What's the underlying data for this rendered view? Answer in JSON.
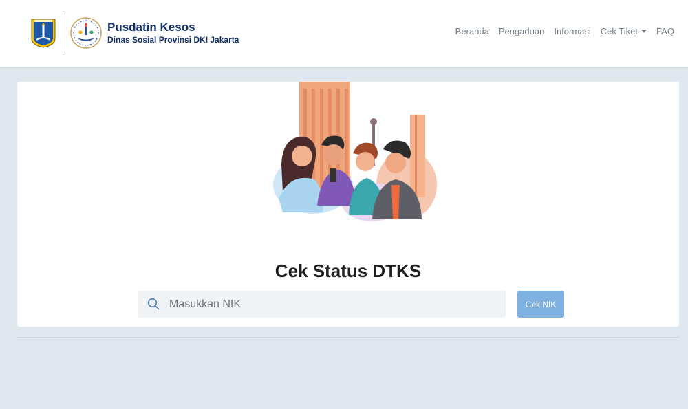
{
  "header": {
    "brand_title": "Pusdatin Kesos",
    "brand_subtitle": "Dinas Sosial Provinsi DKI Jakarta",
    "nav": [
      {
        "label": "Beranda"
      },
      {
        "label": "Pengaduan"
      },
      {
        "label": "Informasi"
      },
      {
        "label": "Cek Tiket"
      },
      {
        "label": "FAQ"
      }
    ]
  },
  "main": {
    "title": "Cek Status DTKS",
    "search": {
      "placeholder": "Masukkan NIK",
      "value": ""
    },
    "button_label": "Cek NIK"
  },
  "colors": {
    "brand": "#14316b",
    "button": "#7eb1e0",
    "background": "#dfe7f0"
  },
  "icons": [
    "dki-jakarta-logo",
    "dinsos-logo",
    "search-icon",
    "caret-down-icon"
  ]
}
